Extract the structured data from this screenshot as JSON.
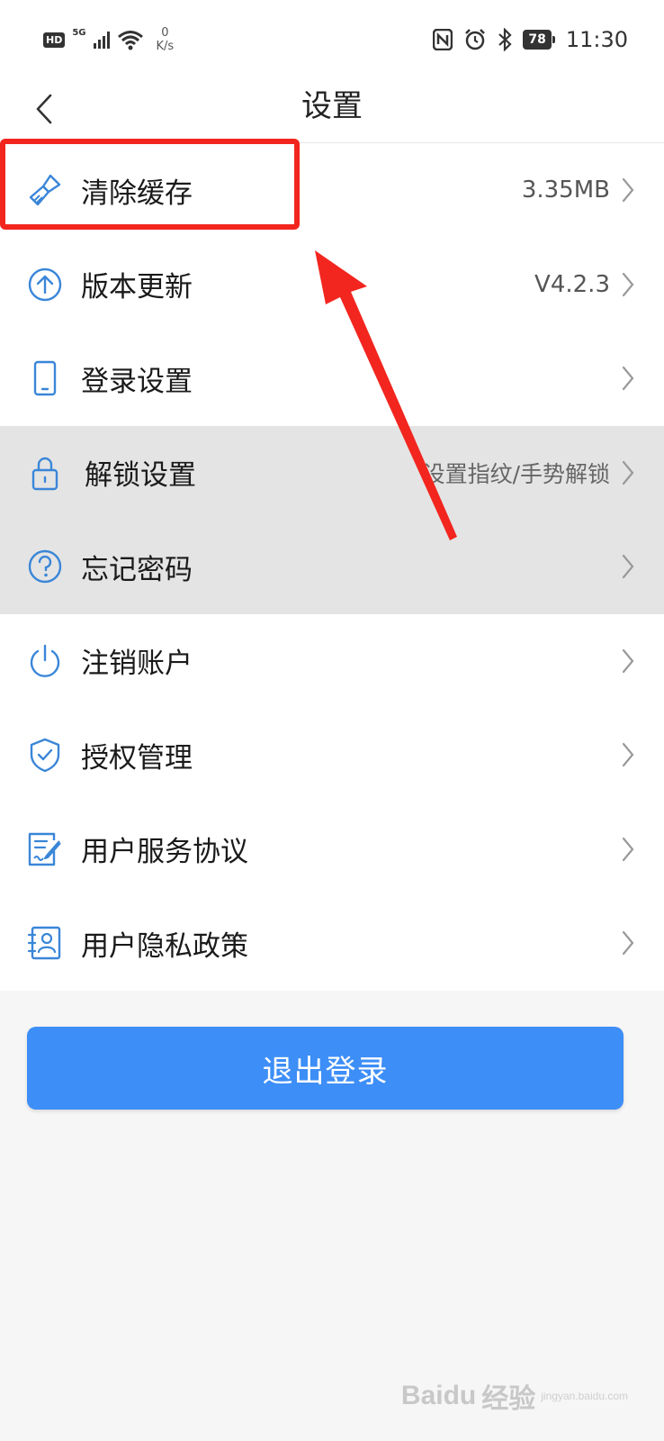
{
  "status_bar": {
    "hd": "HD",
    "network": "5G",
    "speed_value": "0",
    "speed_unit": "K/s",
    "battery": "78",
    "time": "11:30"
  },
  "nav": {
    "title": "设置"
  },
  "settings": [
    {
      "label": "清除缓存",
      "value": "3.35MB",
      "icon": "brush-icon"
    },
    {
      "label": "版本更新",
      "value": "V4.2.3",
      "icon": "arrow-up-circle-icon"
    },
    {
      "label": "登录设置",
      "value": "",
      "icon": "phone-icon"
    },
    {
      "label": "解锁设置",
      "value": "设置指纹/手势解锁",
      "icon": "lock-icon"
    },
    {
      "label": "忘记密码",
      "value": "",
      "icon": "question-circle-icon"
    },
    {
      "label": "注销账户",
      "value": "",
      "icon": "power-icon"
    },
    {
      "label": "授权管理",
      "value": "",
      "icon": "shield-check-icon"
    },
    {
      "label": "用户服务协议",
      "value": "",
      "icon": "document-edit-icon"
    },
    {
      "label": "用户隐私政策",
      "value": "",
      "icon": "contact-card-icon"
    }
  ],
  "logout_label": "退出登录",
  "colors": {
    "accent": "#3d8ef7",
    "icon": "#3a86d8",
    "annotation_red": "#f2261f"
  },
  "watermark": {
    "brand": "Baidu",
    "suffix": "经验",
    "url": "jingyan.baidu.com"
  }
}
